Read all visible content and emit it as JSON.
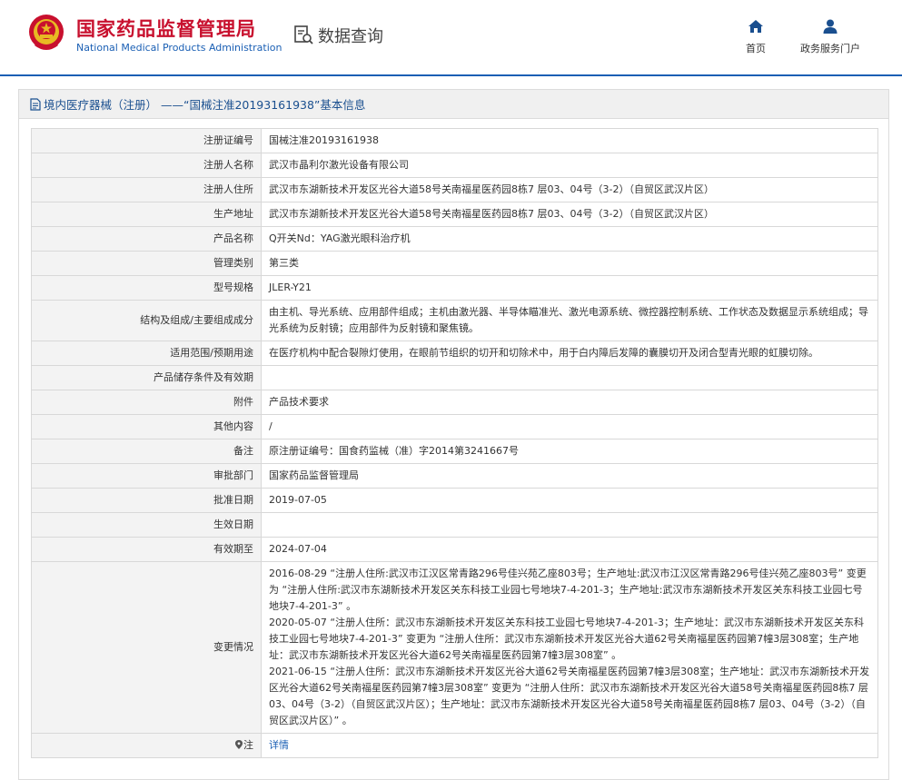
{
  "header": {
    "brand_cn": "国家药品监督管理局",
    "brand_en": "National Medical Products Administration",
    "query_title": "数据查询",
    "nav": [
      {
        "label": "首页",
        "icon": "home-icon"
      },
      {
        "label": "政务服务门户",
        "icon": "user-icon"
      }
    ]
  },
  "colors": {
    "brand_red": "#c8102e",
    "brand_blue": "#1a5fb4",
    "label_bg": "#f3f3f3"
  },
  "panel": {
    "title": "境内医疗器械（注册） ——“国械注准20193161938”基本信息"
  },
  "rows": [
    {
      "label": "注册证编号",
      "value": "国械注准20193161938"
    },
    {
      "label": "注册人名称",
      "value": "武汉市晶利尔激光设备有限公司"
    },
    {
      "label": "注册人住所",
      "value": "武汉市东湖新技术开发区光谷大道58号关南福星医药园8栋7 层03、04号（3-2）（自贸区武汉片区）"
    },
    {
      "label": "生产地址",
      "value": "武汉市东湖新技术开发区光谷大道58号关南福星医药园8栋7 层03、04号（3-2）（自贸区武汉片区）"
    },
    {
      "label": "产品名称",
      "value": "Q开关Nd：YAG激光眼科治疗机"
    },
    {
      "label": "管理类别",
      "value": "第三类"
    },
    {
      "label": "型号规格",
      "value": "JLER-Y21"
    },
    {
      "label": "结构及组成/主要组成成分",
      "value": "由主机、导光系统、应用部件组成；主机由激光器、半导体瞄准光、激光电源系统、微控器控制系统、工作状态及数据显示系统组成；导光系统为反射镜；应用部件为反射镜和聚焦镜。"
    },
    {
      "label": "适用范围/预期用途",
      "value": "在医疗机构中配合裂隙灯使用，在眼前节组织的切开和切除术中，用于白内障后发障的囊膜切开及闭合型青光眼的虹膜切除。"
    },
    {
      "label": "产品储存条件及有效期",
      "value": ""
    },
    {
      "label": "附件",
      "value": "产品技术要求"
    },
    {
      "label": "其他内容",
      "value": "/"
    },
    {
      "label": "备注",
      "value": "原注册证编号：国食药监械（准）字2014第3241667号"
    },
    {
      "label": "审批部门",
      "value": "国家药品监督管理局"
    },
    {
      "label": "批准日期",
      "value": "2019-07-05"
    },
    {
      "label": "生效日期",
      "value": ""
    },
    {
      "label": "有效期至",
      "value": "2024-07-04"
    },
    {
      "label": "变更情况",
      "value": "2016-08-29 “注册人住所:武汉市江汉区常青路296号佳兴苑乙座803号；生产地址:武汉市江汉区常青路296号佳兴苑乙座803号” 变更为 “注册人住所:武汉市东湖新技术开发区关东科技工业园七号地块7-4-201-3；生产地址:武汉市东湖新技术开发区关东科技工业园七号地块7-4-201-3” 。\n2020-05-07 “注册人住所：武汉市东湖新技术开发区关东科技工业园七号地块7-4-201-3；生产地址：武汉市东湖新技术开发区关东科技工业园七号地块7-4-201-3” 变更为 “注册人住所：武汉市东湖新技术开发区光谷大道62号关南福星医药园第7幢3层308室；生产地址：武汉市东湖新技术开发区光谷大道62号关南福星医药园第7幢3层308室” 。\n2021-06-15 “注册人住所：武汉市东湖新技术开发区光谷大道62号关南福星医药园第7幢3层308室；生产地址：武汉市东湖新技术开发区光谷大道62号关南福星医药园第7幢3层308室” 变更为 “注册人住所：武汉市东湖新技术开发区光谷大道58号关南福星医药园8栋7 层03、04号（3-2）（自贸区武汉片区）；生产地址：武汉市东湖新技术开发区光谷大道58号关南福星医药园8栋7 层03、04号（3-2）（自贸区武汉片区）” 。"
    }
  ],
  "note_row": {
    "label": "注",
    "link": "详情",
    "icon": "pin-icon"
  }
}
